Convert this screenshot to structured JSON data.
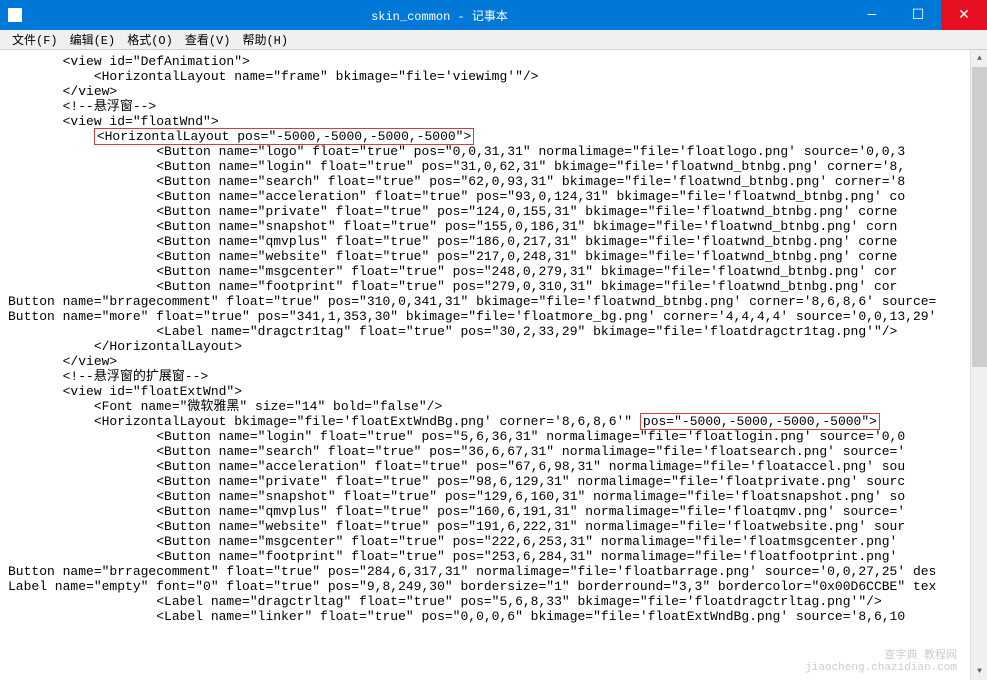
{
  "titlebar": {
    "title": "skin_common - 记事本",
    "min": "—",
    "max": "☐",
    "close": "✕"
  },
  "menu": {
    "file": "文件(F)",
    "edit": "编辑(E)",
    "format": "格式(O)",
    "view": "查看(V)",
    "help": "帮助(H)"
  },
  "hl": {
    "line_horiz_pos": "<HorizontalLayout pos=\"-5000,-5000,-5000,-5000\">",
    "line_pos_attr": "pos=\"-5000,-5000,-5000,-5000\">"
  },
  "lines": {
    "l01": "       <view id=\"DefAnimation\">",
    "l02": "           <HorizontalLayout name=\"frame\" bkimage=\"file='viewimg'\"/>",
    "l03": "       </view>",
    "l04": "       <!--悬浮窗-->",
    "l05": "       <view id=\"floatWnd\">",
    "l06_pre": "           ",
    "l07": "                   <Button name=\"logo\" float=\"true\" pos=\"0,0,31,31\" normalimage=\"file='floatlogo.png' source='0,0,3",
    "l08": "                   <Button name=\"login\" float=\"true\" pos=\"31,0,62,31\" bkimage=\"file='floatwnd_btnbg.png' corner='8,",
    "l09": "                   <Button name=\"search\" float=\"true\" pos=\"62,0,93,31\" bkimage=\"file='floatwnd_btnbg.png' corner='8",
    "l10": "                   <Button name=\"acceleration\" float=\"true\" pos=\"93,0,124,31\" bkimage=\"file='floatwnd_btnbg.png' co",
    "l11": "                   <Button name=\"private\" float=\"true\" pos=\"124,0,155,31\" bkimage=\"file='floatwnd_btnbg.png' corne",
    "l12": "                   <Button name=\"snapshot\" float=\"true\" pos=\"155,0,186,31\" bkimage=\"file='floatwnd_btnbg.png' corn",
    "l13": "                   <Button name=\"qmvplus\" float=\"true\" pos=\"186,0,217,31\" bkimage=\"file='floatwnd_btnbg.png' corne",
    "l14": "                   <Button name=\"website\" float=\"true\" pos=\"217,0,248,31\" bkimage=\"file='floatwnd_btnbg.png' corne",
    "l15": "                   <Button name=\"msgcenter\" float=\"true\" pos=\"248,0,279,31\" bkimage=\"file='floatwnd_btnbg.png' cor",
    "l16": "                   <Button name=\"footprint\" float=\"true\" pos=\"279,0,310,31\" bkimage=\"file='floatwnd_btnbg.png' cor",
    "l17": "Button name=\"brragecomment\" float=\"true\" pos=\"310,0,341,31\" bkimage=\"file='floatwnd_btnbg.png' corner='8,6,8,6' source=",
    "l18": "Button name=\"more\" float=\"true\" pos=\"341,1,353,30\" bkimage=\"file='floatmore_bg.png' corner='4,4,4,4' source='0,0,13,29'",
    "l19": "                   <Label name=\"dragctr1tag\" float=\"true\" pos=\"30,2,33,29\" bkimage=\"file='floatdragctr1tag.png'\"/>",
    "l20": "           </HorizontalLayout>",
    "l21": "       </view>",
    "l22": "       <!--悬浮窗的扩展窗-->",
    "l23": "       <view id=\"floatExtWnd\">",
    "l24": "           <Font name=\"微软雅黑\" size=\"14\" bold=\"false\"/>",
    "l25_pre": "           <HorizontalLayout bkimage=\"file='floatExtWndBg.png' corner='8,6,8,6'\" ",
    "l26": "                   <Button name=\"login\" float=\"true\" pos=\"5,6,36,31\" normalimage=\"file='floatlogin.png' source='0,0",
    "l27": "                   <Button name=\"search\" float=\"true\" pos=\"36,6,67,31\" normalimage=\"file='floatsearch.png' source='",
    "l28": "                   <Button name=\"acceleration\" float=\"true\" pos=\"67,6,98,31\" normalimage=\"file='floataccel.png' sou",
    "l29": "                   <Button name=\"private\" float=\"true\" pos=\"98,6,129,31\" normalimage=\"file='floatprivate.png' sourc",
    "l30": "                   <Button name=\"snapshot\" float=\"true\" pos=\"129,6,160,31\" normalimage=\"file='floatsnapshot.png' so",
    "l31": "                   <Button name=\"qmvplus\" float=\"true\" pos=\"160,6,191,31\" normalimage=\"file='floatqmv.png' source='",
    "l32": "                   <Button name=\"website\" float=\"true\" pos=\"191,6,222,31\" normalimage=\"file='floatwebsite.png' sour",
    "l33": "                   <Button name=\"msgcenter\" float=\"true\" pos=\"222,6,253,31\" normalimage=\"file='floatmsgcenter.png' ",
    "l34": "                   <Button name=\"footprint\" float=\"true\" pos=\"253,6,284,31\" normalimage=\"file='floatfootprint.png' ",
    "l35": "Button name=\"brragecomment\" float=\"true\" pos=\"284,6,317,31\" normalimage=\"file='floatbarrage.png' source='0,0,27,25' des",
    "l36": "Label name=\"empty\" font=\"0\" float=\"true\" pos=\"9,8,249,30\" bordersize=\"1\" borderround=\"3,3\" bordercolor=\"0x00D6CCBE\" tex",
    "l37": "                   <Label name=\"dragctrltag\" float=\"true\" pos=\"5,6,8,33\" bkimage=\"file='floatdragctrltag.png'\"/>",
    "l38": "                   <Label name=\"linker\" float=\"true\" pos=\"0,0,0,6\" bkimage=\"file='floatExtWndBg.png' source='8,6,10"
  },
  "watermark": {
    "line1": "查字典",
    "line2": "jiaocheng.chazidian.com"
  },
  "scroll": {
    "up": "▲",
    "down": "▼"
  }
}
